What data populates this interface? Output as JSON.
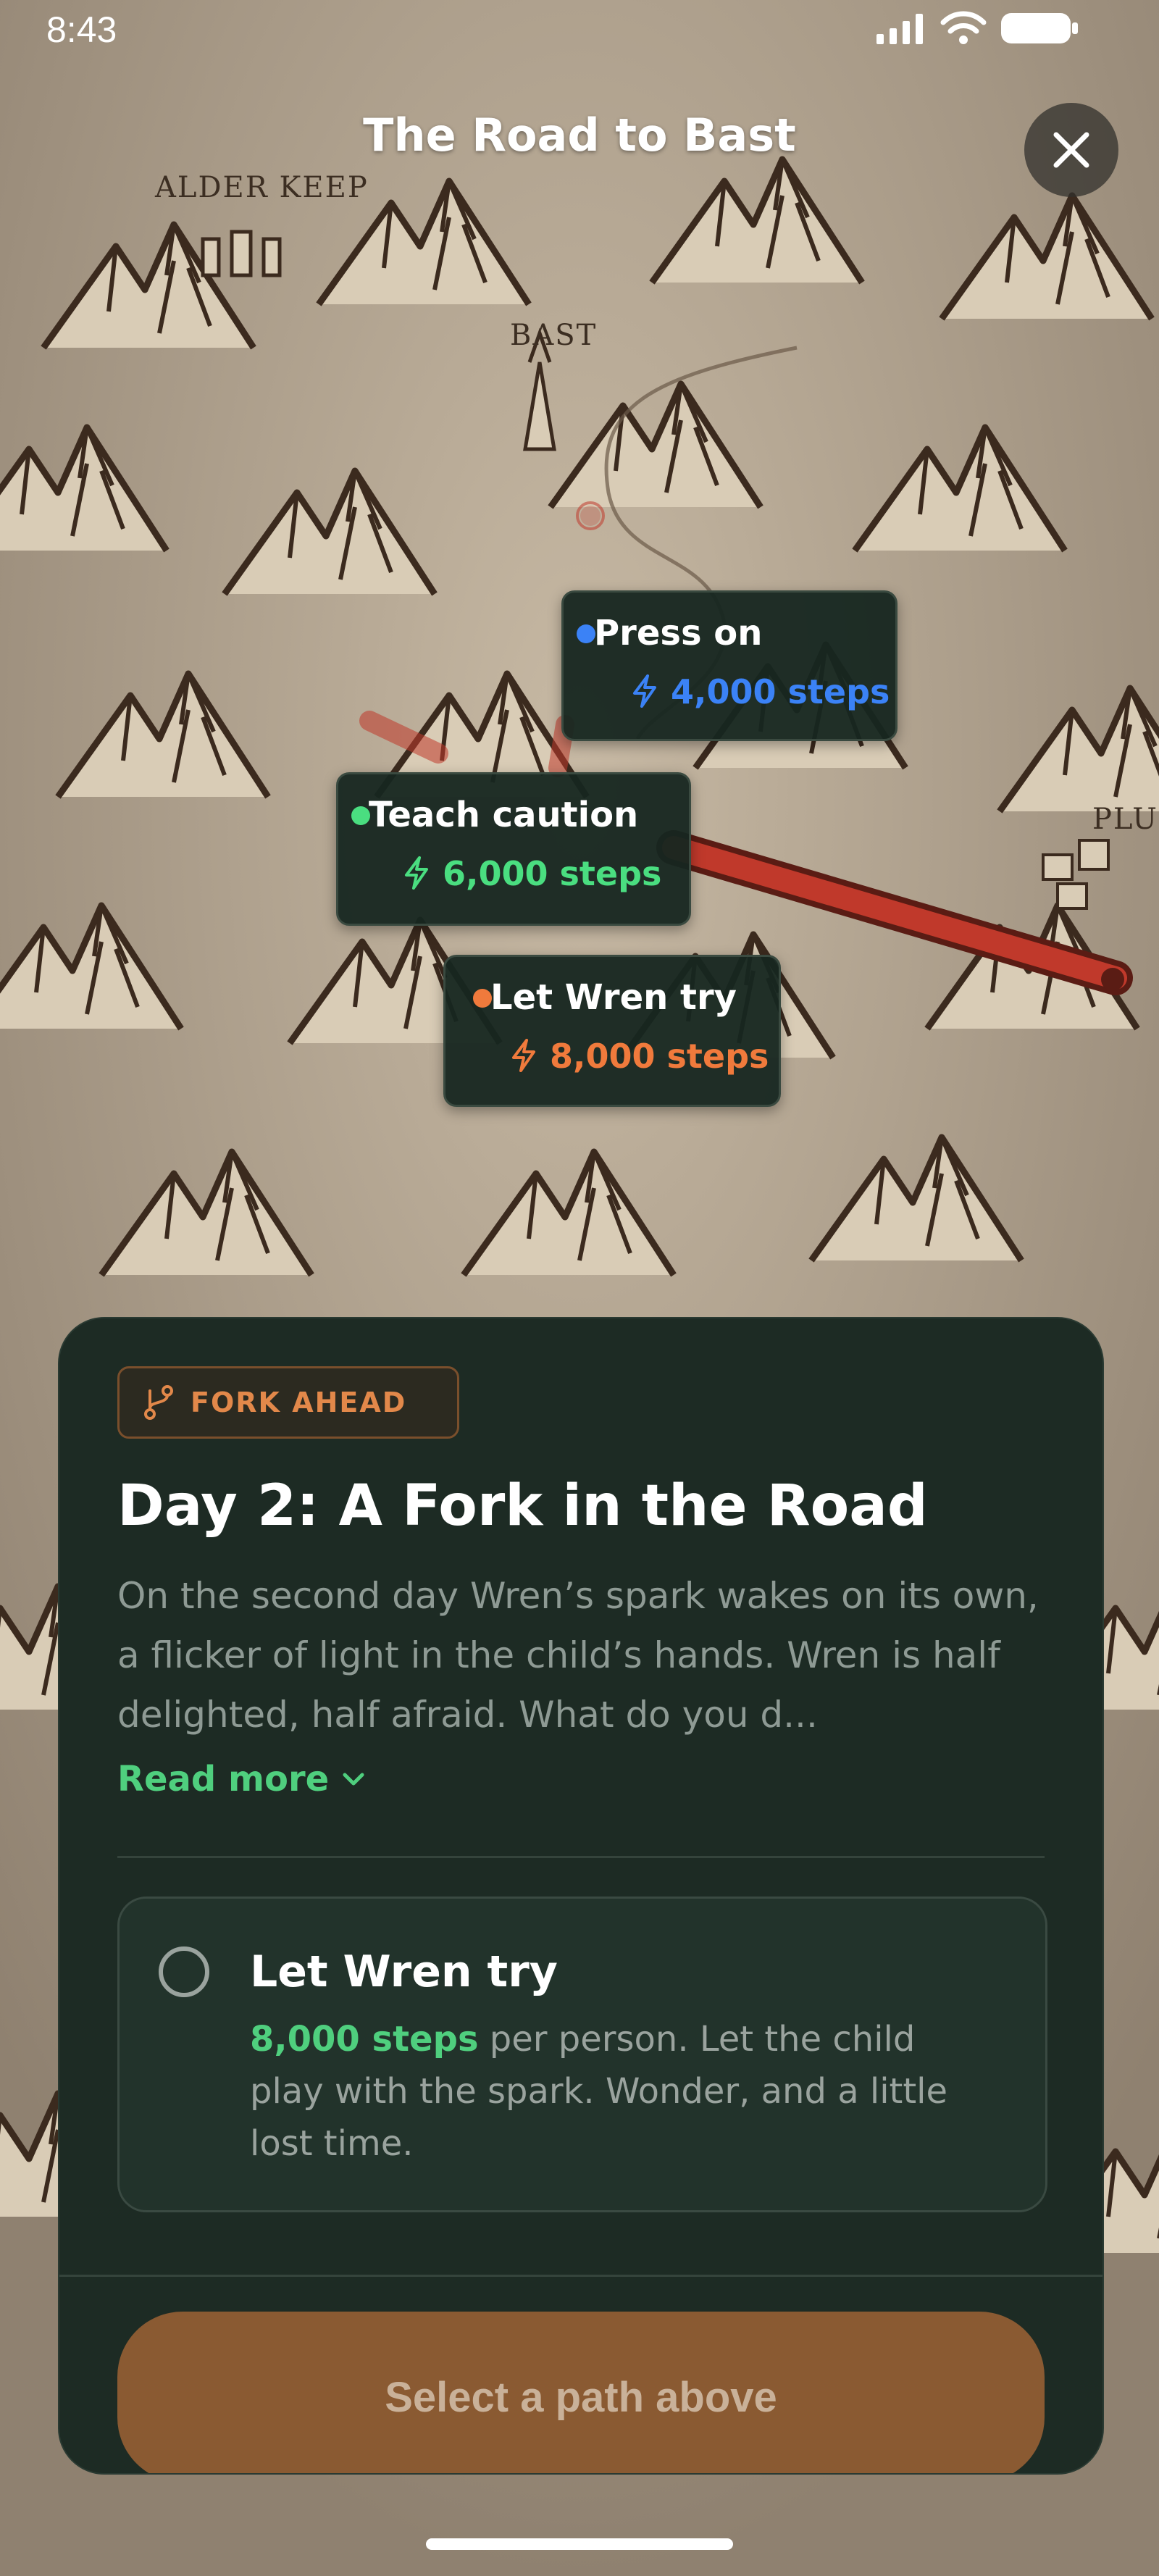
{
  "status_bar": {
    "time": "8:43"
  },
  "header": {
    "title": "The Road to Bast"
  },
  "map": {
    "labels": {
      "alder_keep": "ALDER KEEP",
      "bast": "BAST",
      "plum": "PLUM"
    },
    "choices": [
      {
        "name": "Press on",
        "steps": "4,000 steps",
        "color": "#3b82f6"
      },
      {
        "name": "Teach caution",
        "steps": "6,000 steps",
        "color": "#4ade80"
      },
      {
        "name": "Let Wren try",
        "steps": "8,000 steps",
        "color": "#f07a3c"
      }
    ],
    "route_color": "#c0392b"
  },
  "panel": {
    "badge": "FORK AHEAD",
    "badge_icon": "git-fork-icon",
    "title": "Day 2: A Fork in the Road",
    "description": "On the second day Wren’s spark wakes on its own, a flicker of light in the child’s hands. Wren is half delighted, half afraid. What do you d...",
    "read_more": "Read more",
    "options": [
      {
        "name": "Let Wren try",
        "steps": "8,000 steps",
        "rest": " per person. Let the child play with the spark. Wonder, and a little lost time."
      }
    ],
    "cta": "Select a path above"
  },
  "colors": {
    "panel_bg": "#1d2b24",
    "accent_green": "#4fcf7e",
    "accent_orange": "#e2884a",
    "cta_bg": "#8a5a32"
  }
}
